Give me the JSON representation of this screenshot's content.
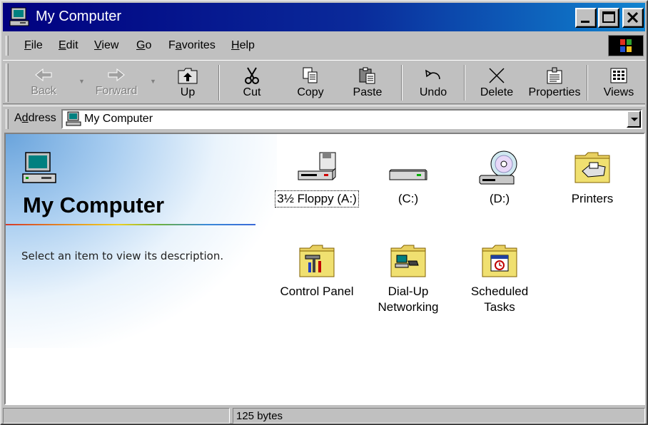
{
  "window": {
    "title": "My Computer",
    "colors": {
      "titlebar_start": "#000080",
      "titlebar_end": "#1084d0",
      "face": "#c0c0c0"
    }
  },
  "menu": {
    "items": [
      {
        "accel": "F",
        "rest": "ile"
      },
      {
        "accel": "E",
        "rest": "dit"
      },
      {
        "accel": "V",
        "rest": "iew"
      },
      {
        "accel": "G",
        "rest": "o"
      },
      {
        "accel": "a",
        "pre": "F",
        "rest": "vorites"
      },
      {
        "accel": "H",
        "rest": "elp"
      }
    ]
  },
  "toolbar": {
    "back": "Back",
    "forward": "Forward",
    "up": "Up",
    "cut": "Cut",
    "copy": "Copy",
    "paste": "Paste",
    "undo": "Undo",
    "delete": "Delete",
    "properties": "Properties",
    "views": "Views"
  },
  "address": {
    "label_accel": "d",
    "label_pre": "A",
    "label_rest": "dress",
    "value": "My Computer"
  },
  "panel": {
    "title": "My Computer",
    "description": "Select an item to view its description."
  },
  "items": {
    "floppy": "3½ Floppy (A:)",
    "c_drive": "(C:)",
    "d_drive": "(D:)",
    "printers": "Printers",
    "control_panel": "Control Panel",
    "dialup_1": "Dial-Up",
    "dialup_2": "Networking",
    "scheduled_1": "Scheduled",
    "scheduled_2": "Tasks"
  },
  "status": {
    "left": "",
    "right": "125 bytes"
  }
}
